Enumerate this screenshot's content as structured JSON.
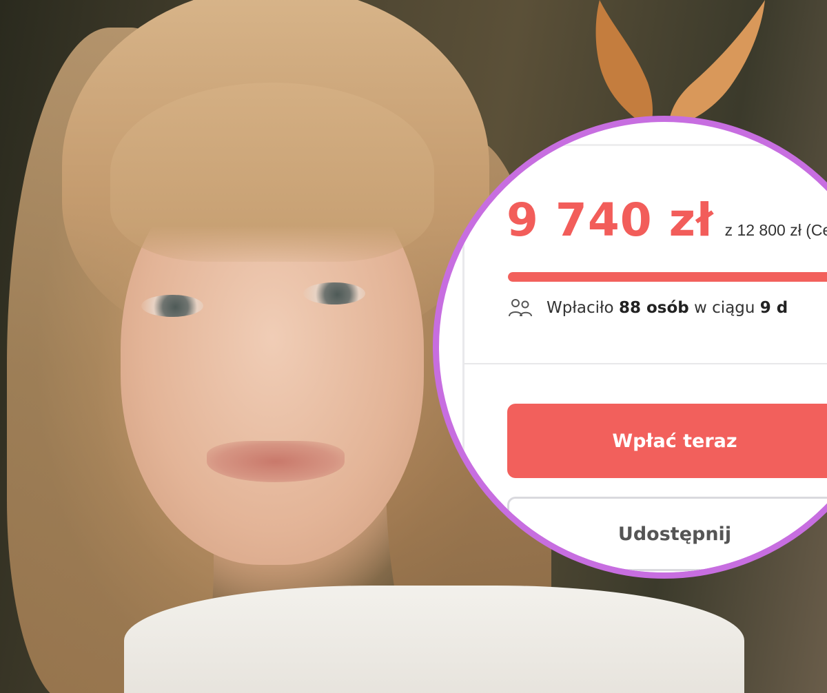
{
  "fundraiser": {
    "raised_amount": "9 740 zł",
    "goal_text": "z 12 800 zł (Ce",
    "progress_fraction": 0.761,
    "donors_prefix": "Wpłaciło",
    "donors_count": "88 osób",
    "donors_middle": "w ciągu",
    "donors_days": "9 d",
    "pay_button_label": "Wpłać teraz",
    "share_button_label": "Udostępnij"
  },
  "icons": {
    "donors": "people-icon"
  },
  "colors": {
    "accent": "#f2605c",
    "highlight_ring": "#c76ee0",
    "logo_leaf_dark": "#c47d3e",
    "logo_leaf_light": "#d9985a"
  }
}
